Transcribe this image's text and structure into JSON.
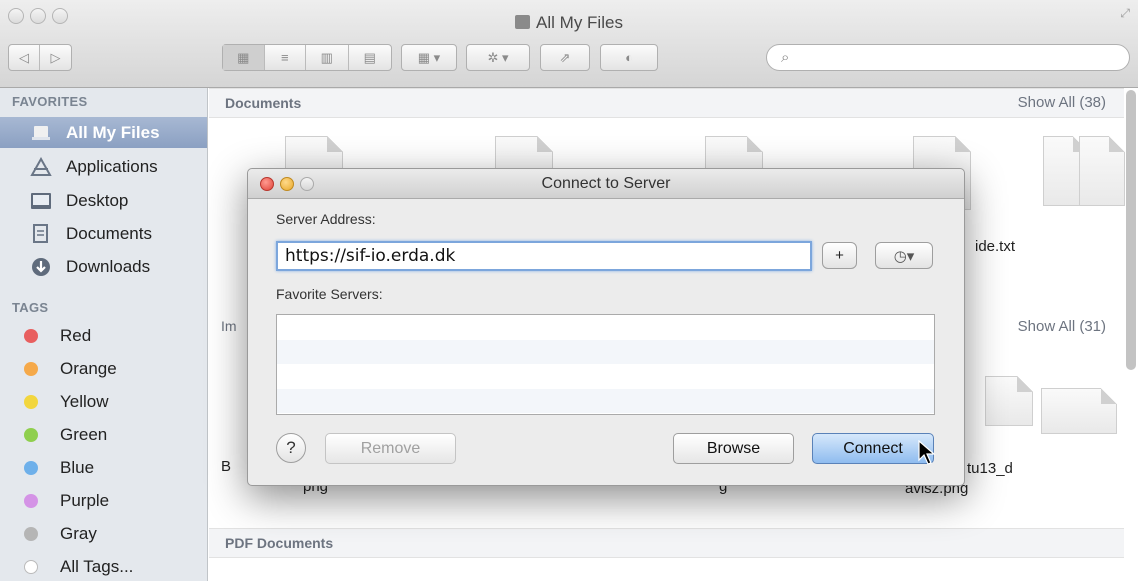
{
  "window": {
    "title": "All My Files",
    "search_placeholder": ""
  },
  "sidebar": {
    "favorites_header": "FAVORITES",
    "favorites": [
      {
        "label": "All My Files",
        "icon": "all-my-files-icon"
      },
      {
        "label": "Applications",
        "icon": "applications-icon"
      },
      {
        "label": "Desktop",
        "icon": "desktop-icon"
      },
      {
        "label": "Documents",
        "icon": "documents-icon"
      },
      {
        "label": "Downloads",
        "icon": "downloads-icon"
      }
    ],
    "tags_header": "TAGS",
    "tags": [
      {
        "label": "Red",
        "color": "#e85f5f"
      },
      {
        "label": "Orange",
        "color": "#f5a94a"
      },
      {
        "label": "Yellow",
        "color": "#f2d63e"
      },
      {
        "label": "Green",
        "color": "#8fcf4e"
      },
      {
        "label": "Blue",
        "color": "#6eb0ea"
      },
      {
        "label": "Purple",
        "color": "#d493e6"
      },
      {
        "label": "Gray",
        "color": "#b5b5b5"
      },
      {
        "label": "All Tags...",
        "color": "#ffffff"
      }
    ]
  },
  "content": {
    "documents": {
      "title": "Documents",
      "show_all": "Show All (38)",
      "file_label": "ide.txt"
    },
    "images": {
      "title": "Im",
      "show_all": "Show All (31)",
      "file_labels": [
        "B",
        "png",
        "g",
        "tu13_d",
        "avisz.png"
      ]
    },
    "pdf": {
      "title": "PDF Documents"
    }
  },
  "dialog": {
    "title": "Connect to Server",
    "server_address_label": "Server Address:",
    "server_address_value": "https://sif-io.erda.dk",
    "add_button": "+",
    "recent_button": "◷▾",
    "favorite_servers_label": "Favorite Servers:",
    "help_button": "?",
    "remove_button": "Remove",
    "browse_button": "Browse",
    "connect_button": "Connect"
  }
}
